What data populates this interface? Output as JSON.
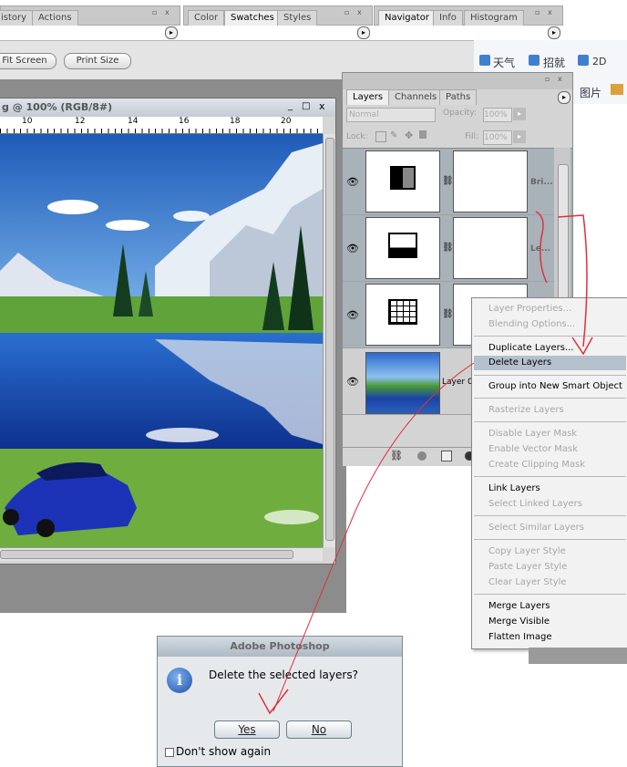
{
  "top_panels": {
    "left_tabs": [
      "istory",
      "Actions"
    ],
    "mid_tabs": [
      "Color",
      "Swatches",
      "Styles"
    ],
    "right_tabs": [
      "Navigator",
      "Info",
      "Histogram"
    ],
    "panel_min": "▫",
    "panel_close": "x",
    "panel_menu": "▸"
  },
  "options_bar": {
    "fit_screen": "Fit Screen",
    "print_size": "Print Size"
  },
  "taskbar": {
    "weather": "天气",
    "recruit": "招就",
    "twod": "2D",
    "image": "图片"
  },
  "document": {
    "title": "g @ 100% (RGB/8#)",
    "ruler": [
      "10",
      "12",
      "14",
      "16",
      "18",
      "20"
    ],
    "win_buttons": [
      "_",
      "□",
      "x"
    ]
  },
  "layers_panel": {
    "tabs": [
      "Layers",
      "Channels",
      "Paths"
    ],
    "blend_mode": "Normal",
    "opacity_label": "Opacity:",
    "opacity_value": "100%",
    "lock_label": "Lock:",
    "fill_label": "Fill:",
    "fill_value": "100%",
    "layers": [
      {
        "name": "Bri...",
        "type": "brightness"
      },
      {
        "name": "Le...",
        "type": "levels"
      },
      {
        "name": "",
        "type": "curves"
      },
      {
        "name": "Layer 0",
        "type": "image"
      }
    ]
  },
  "context_menu": {
    "groups": [
      [
        {
          "label": "Layer Properties...",
          "enabled": false
        },
        {
          "label": "Blending Options...",
          "enabled": false
        }
      ],
      [
        {
          "label": "Duplicate Layers...",
          "enabled": true
        },
        {
          "label": "Delete Layers",
          "enabled": true,
          "highlighted": true
        }
      ],
      [
        {
          "label": "Group into New Smart Object",
          "enabled": true
        }
      ],
      [
        {
          "label": "Rasterize Layers",
          "enabled": false
        }
      ],
      [
        {
          "label": "Disable Layer Mask",
          "enabled": false
        },
        {
          "label": "Enable Vector Mask",
          "enabled": false
        },
        {
          "label": "Create Clipping Mask",
          "enabled": false
        }
      ],
      [
        {
          "label": "Link Layers",
          "enabled": true
        },
        {
          "label": "Select Linked Layers",
          "enabled": false
        }
      ],
      [
        {
          "label": "Select Similar Layers",
          "enabled": false
        }
      ],
      [
        {
          "label": "Copy Layer Style",
          "enabled": false
        },
        {
          "label": "Paste Layer Style",
          "enabled": false
        },
        {
          "label": "Clear Layer Style",
          "enabled": false
        }
      ],
      [
        {
          "label": "Merge Layers",
          "enabled": true
        },
        {
          "label": "Merge Visible",
          "enabled": true
        },
        {
          "label": "Flatten Image",
          "enabled": true
        }
      ]
    ]
  },
  "dialog": {
    "title": "Adobe Photoshop",
    "message": "Delete the selected layers?",
    "yes": "Yes",
    "no": "No",
    "dont_show": "Don't show again",
    "info_glyph": "i"
  },
  "colors": {
    "annotation": "#e0303a",
    "menu_highlight": "#b4c0cc",
    "layers_bg": "#a9b2b9",
    "dialog_title_bg": "#bfc9d2",
    "workspace": "#8c8c8c"
  }
}
